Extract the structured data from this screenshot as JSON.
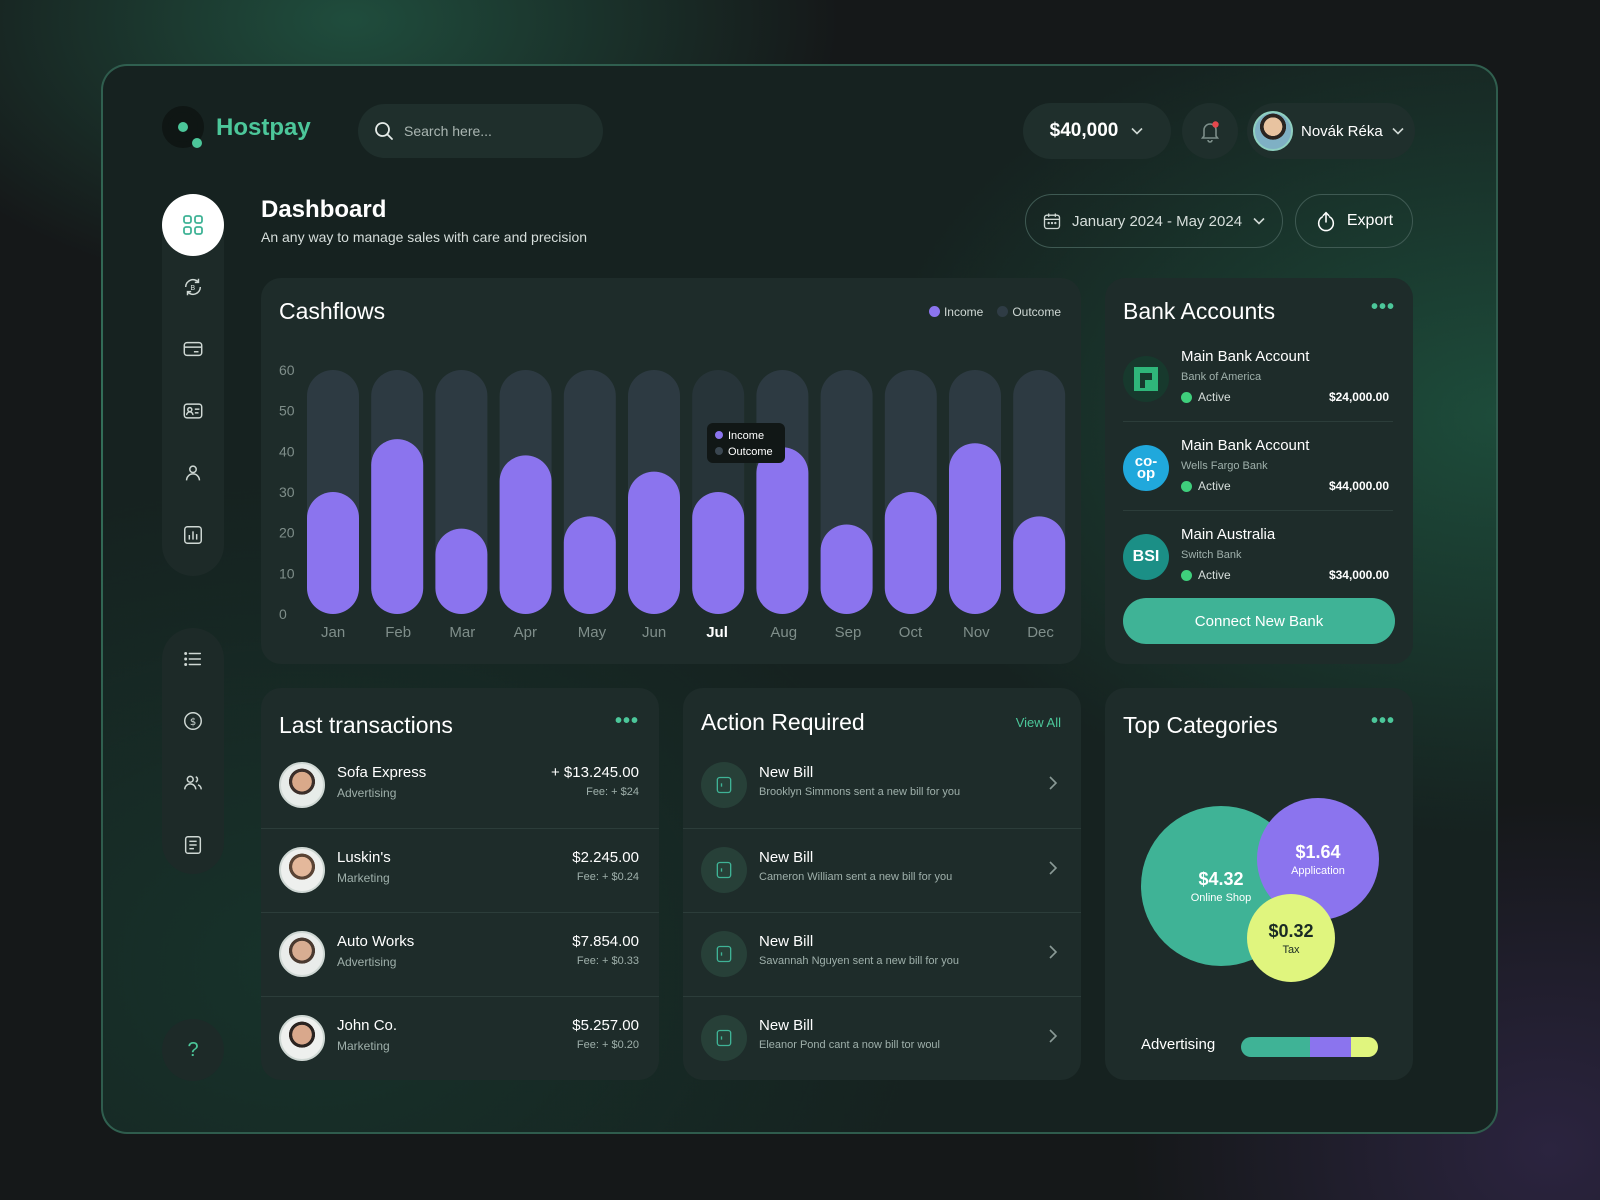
{
  "brand": {
    "name": "Hostpay"
  },
  "search": {
    "placeholder": "Search here..."
  },
  "header": {
    "balance": "$40,000",
    "user_name": "Novák Réka"
  },
  "page": {
    "title": "Dashboard",
    "subtitle": "An any way to manage sales with care and  precision",
    "date_range": "January 2024 - May 2024",
    "export_label": "Export"
  },
  "sidebar": {
    "top_items": [
      "grid-icon",
      "bitcoin-exchange-icon",
      "card-icon",
      "id-card-icon",
      "user-icon",
      "report-chart-icon"
    ],
    "bottom_items": [
      "list-icon",
      "dollar-icon",
      "users-icon",
      "receipt-icon"
    ],
    "help_label": "?"
  },
  "cashflows": {
    "title": "Cashflows",
    "legend": {
      "income": "Income",
      "outcome": "Outcome"
    },
    "tooltip": {
      "income": "Income",
      "outcome": "Outcome"
    }
  },
  "chart_data": {
    "type": "bar",
    "title": "Cashflows",
    "categories": [
      "Jan",
      "Feb",
      "Mar",
      "Apr",
      "May",
      "Jun",
      "Jul",
      "Aug",
      "Sep",
      "Oct",
      "Nov",
      "Dec"
    ],
    "series": [
      {
        "name": "Income",
        "values": [
          30,
          43,
          21,
          39,
          24,
          35,
          30,
          41,
          22,
          30,
          42,
          24
        ]
      },
      {
        "name": "Outcome",
        "values": [
          30,
          17,
          39,
          21,
          36,
          25,
          30,
          19,
          38,
          30,
          18,
          36
        ]
      }
    ],
    "stacked": true,
    "ylim": [
      0,
      60
    ],
    "yticks": [
      60,
      50,
      40,
      30,
      20,
      10,
      0
    ],
    "highlight": "Jul",
    "colors": {
      "income": "#8b74ee",
      "outcome": "#2f3c45"
    },
    "grid": false,
    "legend_position": "top-right"
  },
  "banks": {
    "title": "Bank Accounts",
    "items": [
      {
        "name": "Main Bank Account",
        "bank": "Bank of America",
        "status": "Active",
        "amount": "$24,000.00",
        "logo": "boa-logo"
      },
      {
        "name": "Main Bank Account",
        "bank": "Wells Fargo Bank",
        "status": "Active",
        "amount": "$44,000.00",
        "logo": "co-op"
      },
      {
        "name": "Main Australia",
        "bank": "Switch Bank",
        "status": "Active",
        "amount": "$34,000.00",
        "logo": "BSI"
      }
    ],
    "connect_label": "Connect New Bank"
  },
  "transactions": {
    "title": "Last transactions",
    "items": [
      {
        "name": "Sofa Express",
        "category": "Advertising",
        "amount": "+ $13.245.00",
        "fee": "Fee: + $24"
      },
      {
        "name": "Luskin's",
        "category": "Marketing",
        "amount": "$2.245.00",
        "fee": "Fee: + $0.24"
      },
      {
        "name": "Auto Works",
        "category": "Advertising",
        "amount": "$7.854.00",
        "fee": "Fee: + $0.33"
      },
      {
        "name": "John Co.",
        "category": "Marketing",
        "amount": "$5.257.00",
        "fee": "Fee: + $0.20"
      }
    ]
  },
  "actions": {
    "title": "Action Required",
    "view_all": "View All",
    "items": [
      {
        "name": "New Bill",
        "desc": "Brooklyn Simmons sent a new bill for you"
      },
      {
        "name": "New Bill",
        "desc": "Cameron William sent a new bill for you"
      },
      {
        "name": "New Bill",
        "desc": "Savannah Nguyen sent a new bill for you"
      },
      {
        "name": "New Bill",
        "desc": "Eleanor Pond cant a now bill tor woul"
      }
    ]
  },
  "categories": {
    "title": "Top Categories",
    "bubbles": [
      {
        "value": "$4.32",
        "label": "Online Shop",
        "color": "#3fb396"
      },
      {
        "value": "$1.64",
        "label": "Application",
        "color": "#8b74ee"
      },
      {
        "value": "$0.32",
        "label": "Tax",
        "color": "#e0f57e"
      }
    ],
    "advertising_label": "Advertising",
    "advertising_split": [
      0.5,
      0.3,
      0.2
    ]
  }
}
